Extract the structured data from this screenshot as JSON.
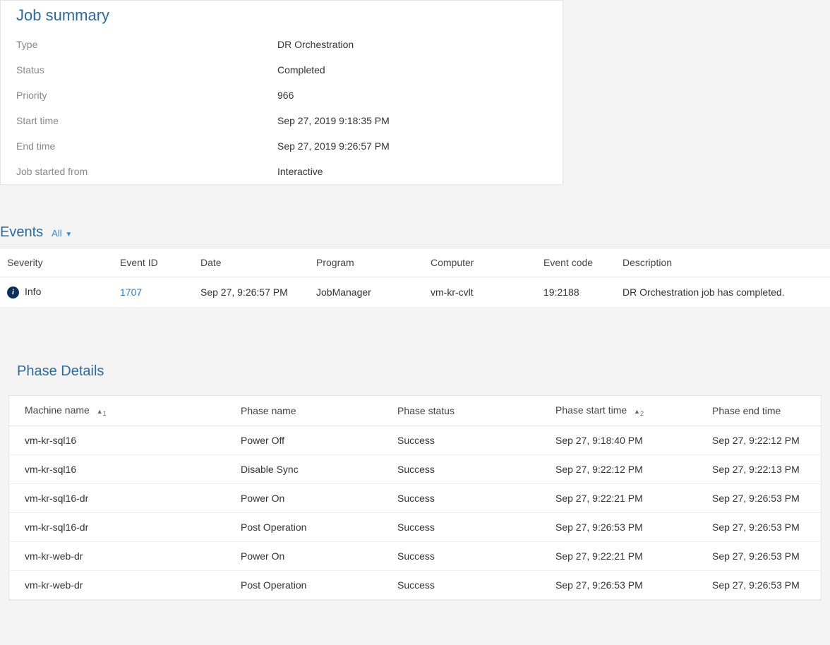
{
  "jobSummary": {
    "title": "Job summary",
    "rows": [
      {
        "label": "Type",
        "value": "DR Orchestration"
      },
      {
        "label": "Status",
        "value": "Completed"
      },
      {
        "label": "Priority",
        "value": "966"
      },
      {
        "label": "Start time",
        "value": "Sep 27, 2019 9:18:35 PM"
      },
      {
        "label": "End time",
        "value": "Sep 27, 2019 9:26:57 PM"
      },
      {
        "label": "Job started from",
        "value": "Interactive"
      }
    ]
  },
  "events": {
    "title": "Events",
    "filter": "All",
    "headers": [
      "Severity",
      "Event ID",
      "Date",
      "Program",
      "Computer",
      "Event code",
      "Description"
    ],
    "rows": [
      {
        "severity": "Info",
        "eventId": "1707",
        "date": "Sep 27, 9:26:57 PM",
        "program": "JobManager",
        "computer": "vm-kr-cvlt",
        "eventCode": "19:2188",
        "description": "DR Orchestration job has completed."
      }
    ]
  },
  "phaseDetails": {
    "title": "Phase Details",
    "headers": {
      "machine": "Machine name",
      "phase": "Phase name",
      "status": "Phase status",
      "start": "Phase start time",
      "end": "Phase end time"
    },
    "rows": [
      {
        "machine": "vm-kr-sql16",
        "phase": "Power Off",
        "status": "Success",
        "start": "Sep 27, 9:18:40 PM",
        "end": "Sep 27, 9:22:12 PM"
      },
      {
        "machine": "vm-kr-sql16",
        "phase": "Disable Sync",
        "status": "Success",
        "start": "Sep 27, 9:22:12 PM",
        "end": "Sep 27, 9:22:13 PM"
      },
      {
        "machine": "vm-kr-sql16-dr",
        "phase": "Power On",
        "status": "Success",
        "start": "Sep 27, 9:22:21 PM",
        "end": "Sep 27, 9:26:53 PM"
      },
      {
        "machine": "vm-kr-sql16-dr",
        "phase": "Post Operation",
        "status": "Success",
        "start": "Sep 27, 9:26:53 PM",
        "end": "Sep 27, 9:26:53 PM"
      },
      {
        "machine": "vm-kr-web-dr",
        "phase": "Power On",
        "status": "Success",
        "start": "Sep 27, 9:22:21 PM",
        "end": "Sep 27, 9:26:53 PM"
      },
      {
        "machine": "vm-kr-web-dr",
        "phase": "Post Operation",
        "status": "Success",
        "start": "Sep 27, 9:26:53 PM",
        "end": "Sep 27, 9:26:53 PM"
      }
    ]
  }
}
